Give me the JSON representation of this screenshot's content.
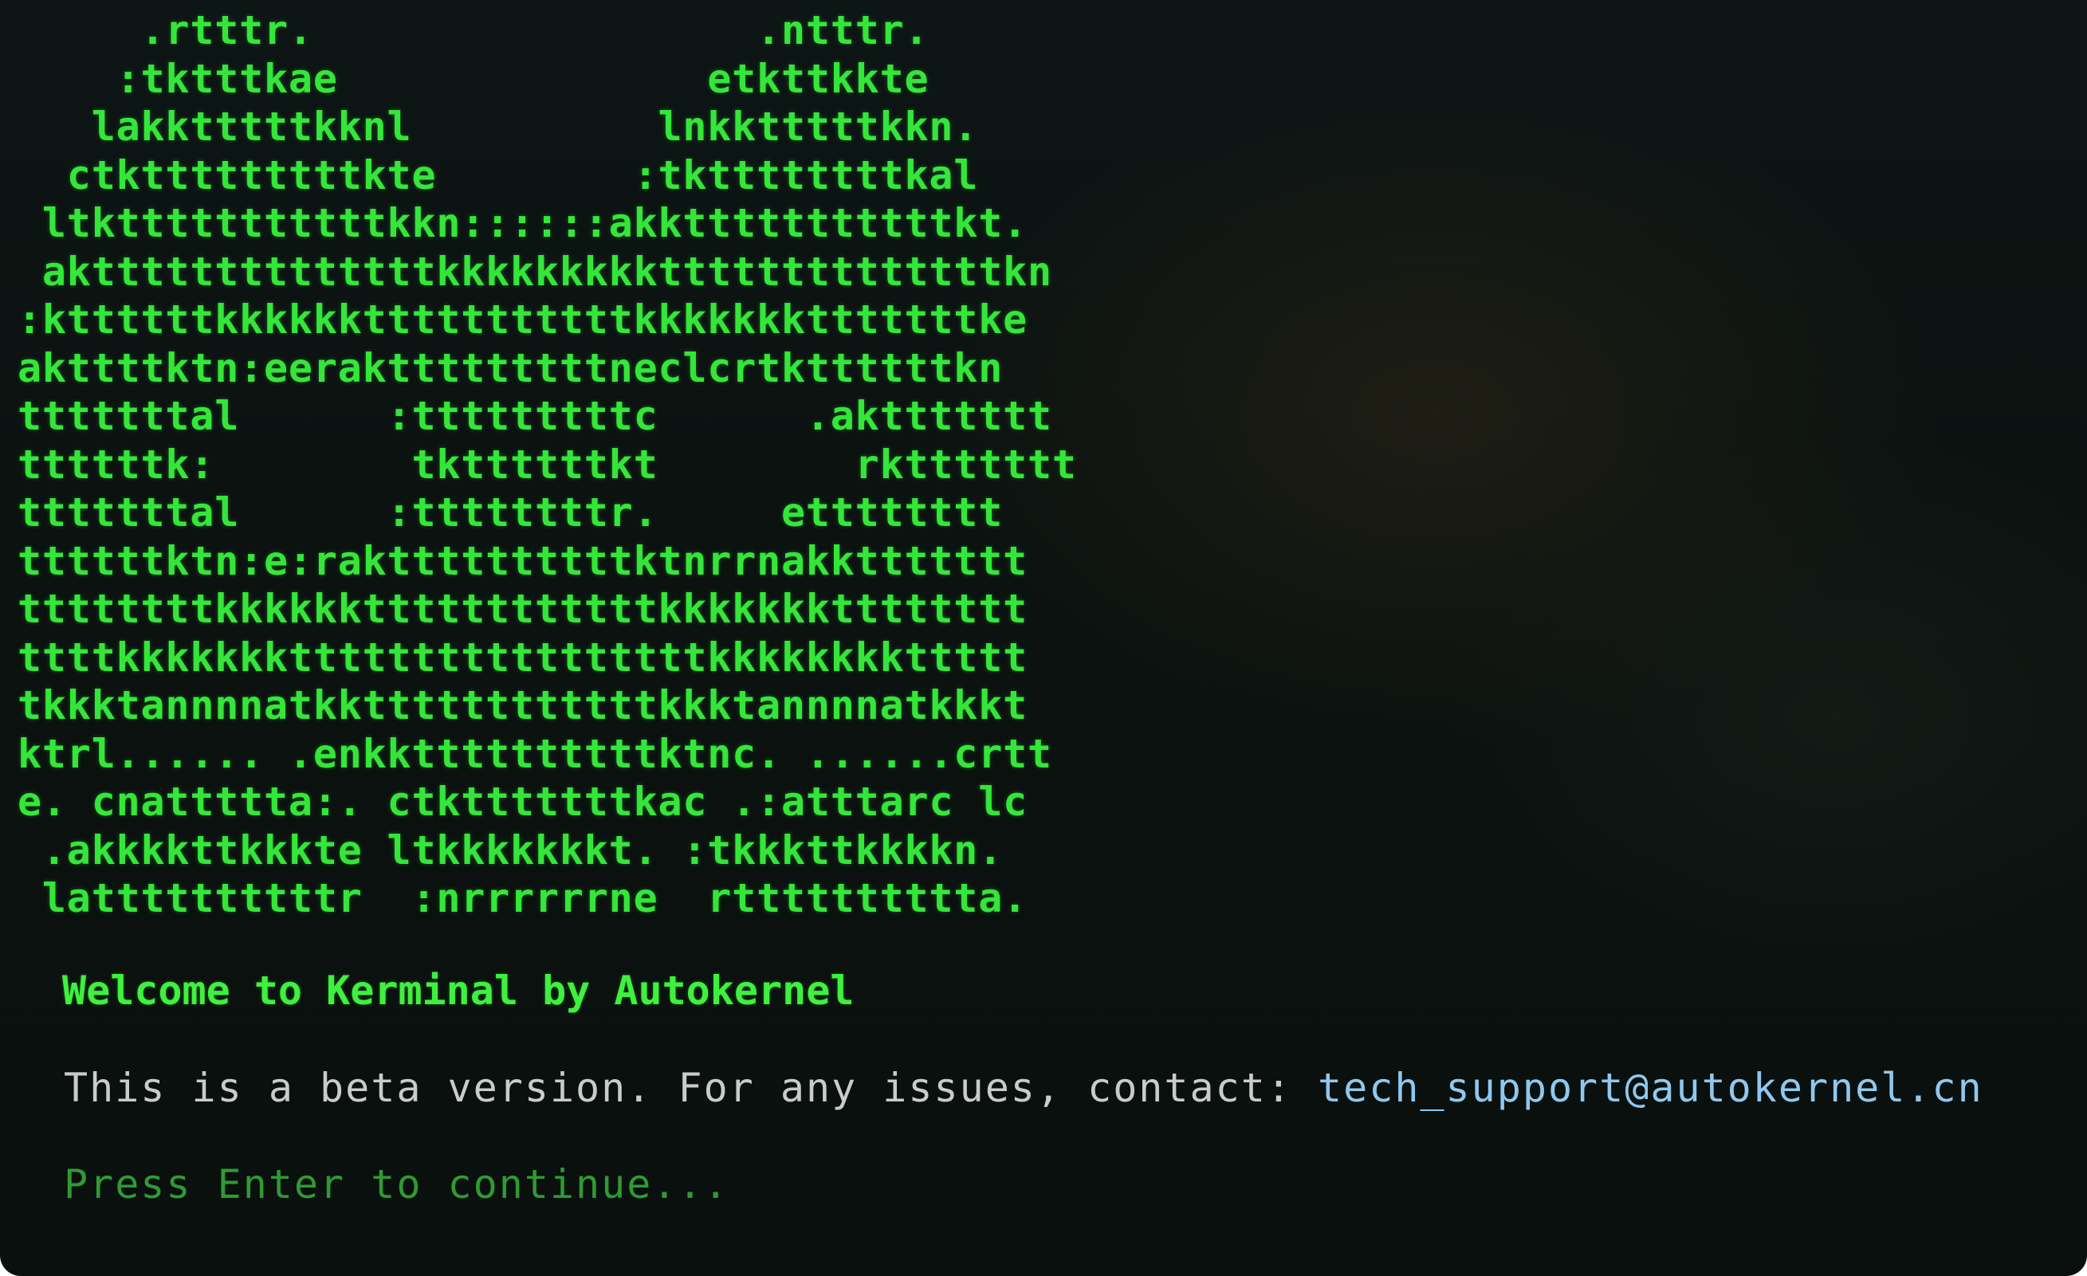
{
  "terminal": {
    "ascii_art": "     .rtttr.                  .ntttr.\n    :tktttkae               etkttkkte\n   lakktttttkknl          lnkktttttkkn.\n  ctktttttttttkte        :tkttttttttkal\n ltktttttttttttkkn::::::akktttttttttttkt.\n akttttttttttttttkkkkkkkkkttttttttttttttkn\n:kttttttkkkkkktttttttttttkkkkkkktttttttke\nakttttktn:eeraktttttttttneclcrtkttttttkn\ntttttttal      :tttttttttc      .akttttttt\nttttttk:        tkttttttkt        rkttttttt\ntttttttal      :ttttttttr.     etttttttt\nttttttktn:e:rakttttttttttktnrrnakkttttttt\nttttttttkkkkkkttttttttttttkkkkkkktttttttt\nttttkkkkkkktttttttttttttttttkkkkkkkkttttt\ntkkktannnnatkkttttttttttttkkktannnnatkkkt\nktrl...... .enkkttttttttttktnc. ......crtt\ne. cnattttta:. ctktttttttkac .:atttarc lc\n .akkkkttkkkte ltkkkkkkkt. :tkkkttkkkkn.\n lattttttttttr  :nrrrrrrne  rtttttttttta.",
    "welcome_prefix": "Welcome to ",
    "welcome_brand": "Kerminal",
    "welcome_suffix": " by Autokernel",
    "beta_message": "This is a beta version. For any issues, contact: ",
    "support_email": "tech_support@autokernel.cn",
    "continue_prompt": "Press Enter to continue..."
  }
}
